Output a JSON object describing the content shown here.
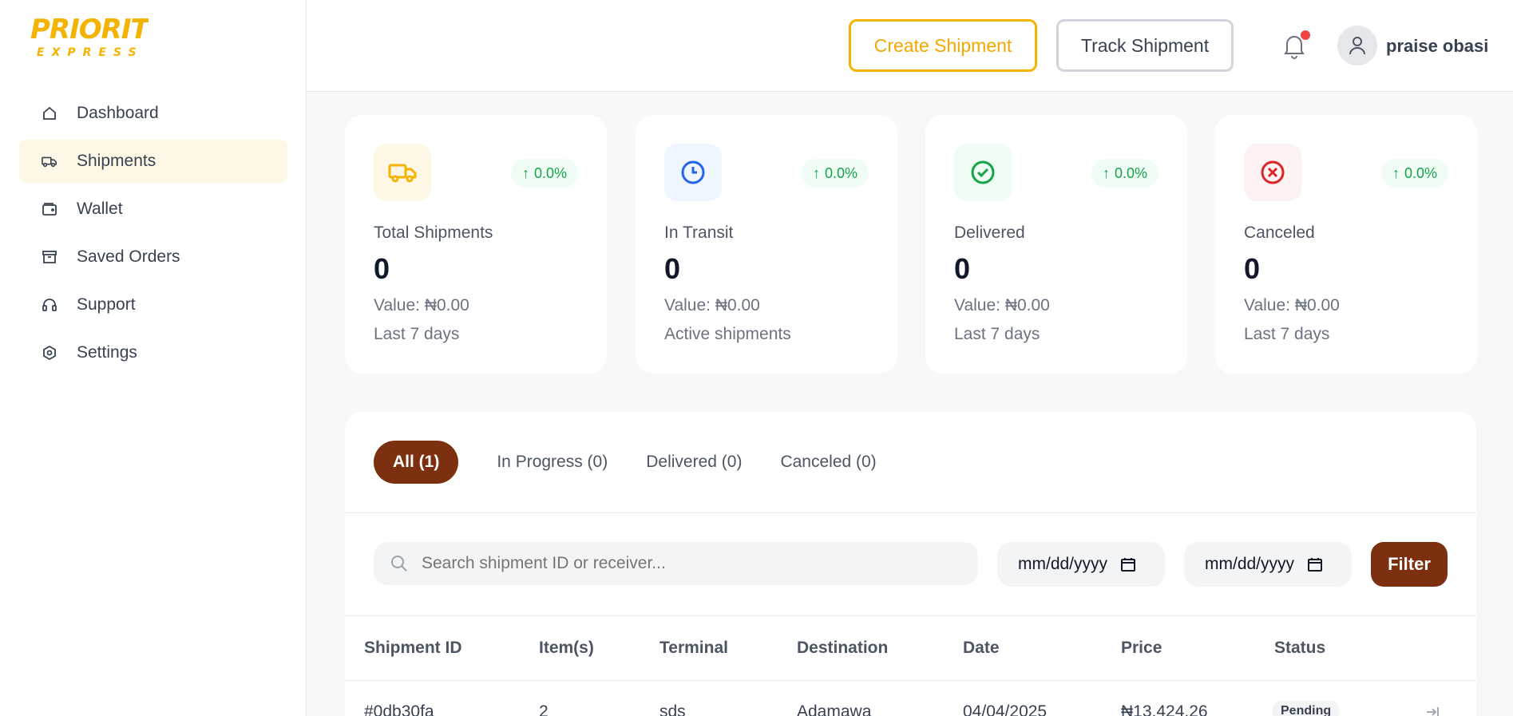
{
  "brand": {
    "logo_text_top": "PRIORITY",
    "logo_text_bottom": "EXPRESS",
    "color": "#f5b301"
  },
  "sidebar": {
    "items": [
      {
        "label": "Dashboard",
        "icon": "home-icon"
      },
      {
        "label": "Shipments",
        "icon": "truck-icon",
        "active": true
      },
      {
        "label": "Wallet",
        "icon": "wallet-icon"
      },
      {
        "label": "Saved Orders",
        "icon": "archive-icon"
      },
      {
        "label": "Support",
        "icon": "headset-icon"
      },
      {
        "label": "Settings",
        "icon": "gear-icon"
      }
    ]
  },
  "header": {
    "create_label": "Create Shipment",
    "track_label": "Track Shipment",
    "username": "praise obasi"
  },
  "stats": [
    {
      "title": "Total Shipments",
      "count": "0",
      "value": "Value: ₦0.00",
      "sub": "Last 7 days",
      "trend": "0.0%",
      "icon": "truck-icon",
      "icon_color": "#f5b301",
      "icon_bg": "#fff7e6"
    },
    {
      "title": "In Transit",
      "count": "0",
      "value": "Value: ₦0.00",
      "sub": "Active shipments",
      "trend": "0.0%",
      "icon": "clock-icon",
      "icon_color": "#2563eb",
      "icon_bg": "#eff6ff"
    },
    {
      "title": "Delivered",
      "count": "0",
      "value": "Value: ₦0.00",
      "sub": "Last 7 days",
      "trend": "0.0%",
      "icon": "check-circle-icon",
      "icon_color": "#16a34a",
      "icon_bg": "#f0fdf4"
    },
    {
      "title": "Canceled",
      "count": "0",
      "value": "Value: ₦0.00",
      "sub": "Last 7 days",
      "trend": "0.0%",
      "icon": "x-circle-icon",
      "icon_color": "#dc2626",
      "icon_bg": "#fef2f2"
    }
  ],
  "tabs": [
    "All (1)",
    "In Progress (0)",
    "Delivered (0)",
    "Canceled (0)"
  ],
  "filters": {
    "search_placeholder": "Search shipment ID or receiver...",
    "date_from": "mm/dd/yyyy",
    "date_to": "mm/dd/yyyy",
    "filter_label": "Filter"
  },
  "table": {
    "headers": [
      "Shipment ID",
      "Item(s)",
      "Terminal",
      "Destination",
      "Date",
      "Price",
      "Status"
    ],
    "rows": [
      [
        "#0db30fa",
        "2",
        "sds",
        "Adamawa",
        "04/04/2025",
        "₦13,424.26",
        "Pending"
      ]
    ]
  },
  "colors": {
    "accent": "#7c300f",
    "brand_yellow": "#f5b301"
  }
}
